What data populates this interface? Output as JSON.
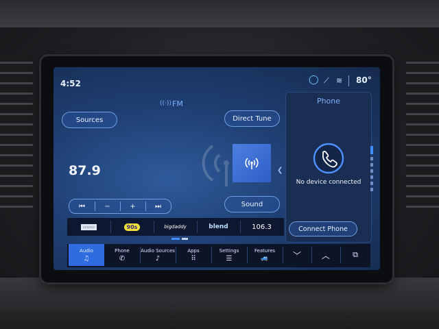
{
  "status": {
    "time": "4:52",
    "temperature": "80°",
    "icons": [
      "assistant-icon",
      "no-signal-icon",
      "wifi-icon"
    ]
  },
  "source": {
    "label": "FM"
  },
  "buttons": {
    "sources": "Sources",
    "direct_tune": "Direct Tune",
    "sound": "Sound"
  },
  "station": {
    "frequency": "87.9"
  },
  "transport": [
    "⏮",
    "−",
    "+",
    "⏭"
  ],
  "presets": [
    {
      "label": "▭▭▭",
      "kind": "logo"
    },
    {
      "label": "90s",
      "kind": "logo"
    },
    {
      "label": "bigdaddy",
      "kind": "logo"
    },
    {
      "label": "blend",
      "kind": "logo"
    },
    {
      "label": "106.3",
      "kind": "text"
    }
  ],
  "phone_panel": {
    "title": "Phone",
    "status": "No device connected",
    "connect_label": "Connect Phone"
  },
  "nav": [
    {
      "label": "Audio",
      "icon": "music-note-icon",
      "glyph": "♫",
      "active": true
    },
    {
      "label": "Phone",
      "icon": "phone-icon",
      "glyph": "✆",
      "active": false
    },
    {
      "label": "Audio Sources",
      "icon": "audio-sources-icon",
      "glyph": "♪",
      "active": false
    },
    {
      "label": "Apps",
      "icon": "apps-grid-icon",
      "glyph": "⠿",
      "active": false
    },
    {
      "label": "Settings",
      "icon": "settings-sliders-icon",
      "glyph": "☰",
      "active": false
    },
    {
      "label": "Features",
      "icon": "car-icon",
      "glyph": "🚙",
      "active": false
    }
  ],
  "colors": {
    "accent": "#2f6ce0",
    "pill_border": "#6f9fe0",
    "text": "#e8f1ff",
    "link": "#7fb2ff"
  }
}
